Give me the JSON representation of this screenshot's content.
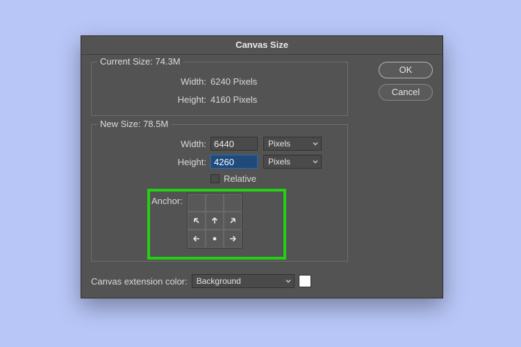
{
  "dialog": {
    "title": "Canvas Size",
    "ok": "OK",
    "cancel": "Cancel"
  },
  "current": {
    "legend": "Current Size: 74.3M",
    "width_label": "Width:",
    "width_value": "6240 Pixels",
    "height_label": "Height:",
    "height_value": "4160 Pixels"
  },
  "newsize": {
    "legend": "New Size: 78.5M",
    "width_label": "Width:",
    "width_value": "6440",
    "width_unit": "Pixels",
    "height_label": "Height:",
    "height_value": "4260",
    "height_unit": "Pixels",
    "relative_label": "Relative",
    "relative_checked": false,
    "anchor_label": "Anchor:",
    "anchor_position": "bottom-center"
  },
  "extension": {
    "label": "Canvas extension color:",
    "value": "Background",
    "swatch_color": "#ffffff"
  },
  "highlight": {
    "target": "anchor-grid",
    "color": "#23d113"
  }
}
